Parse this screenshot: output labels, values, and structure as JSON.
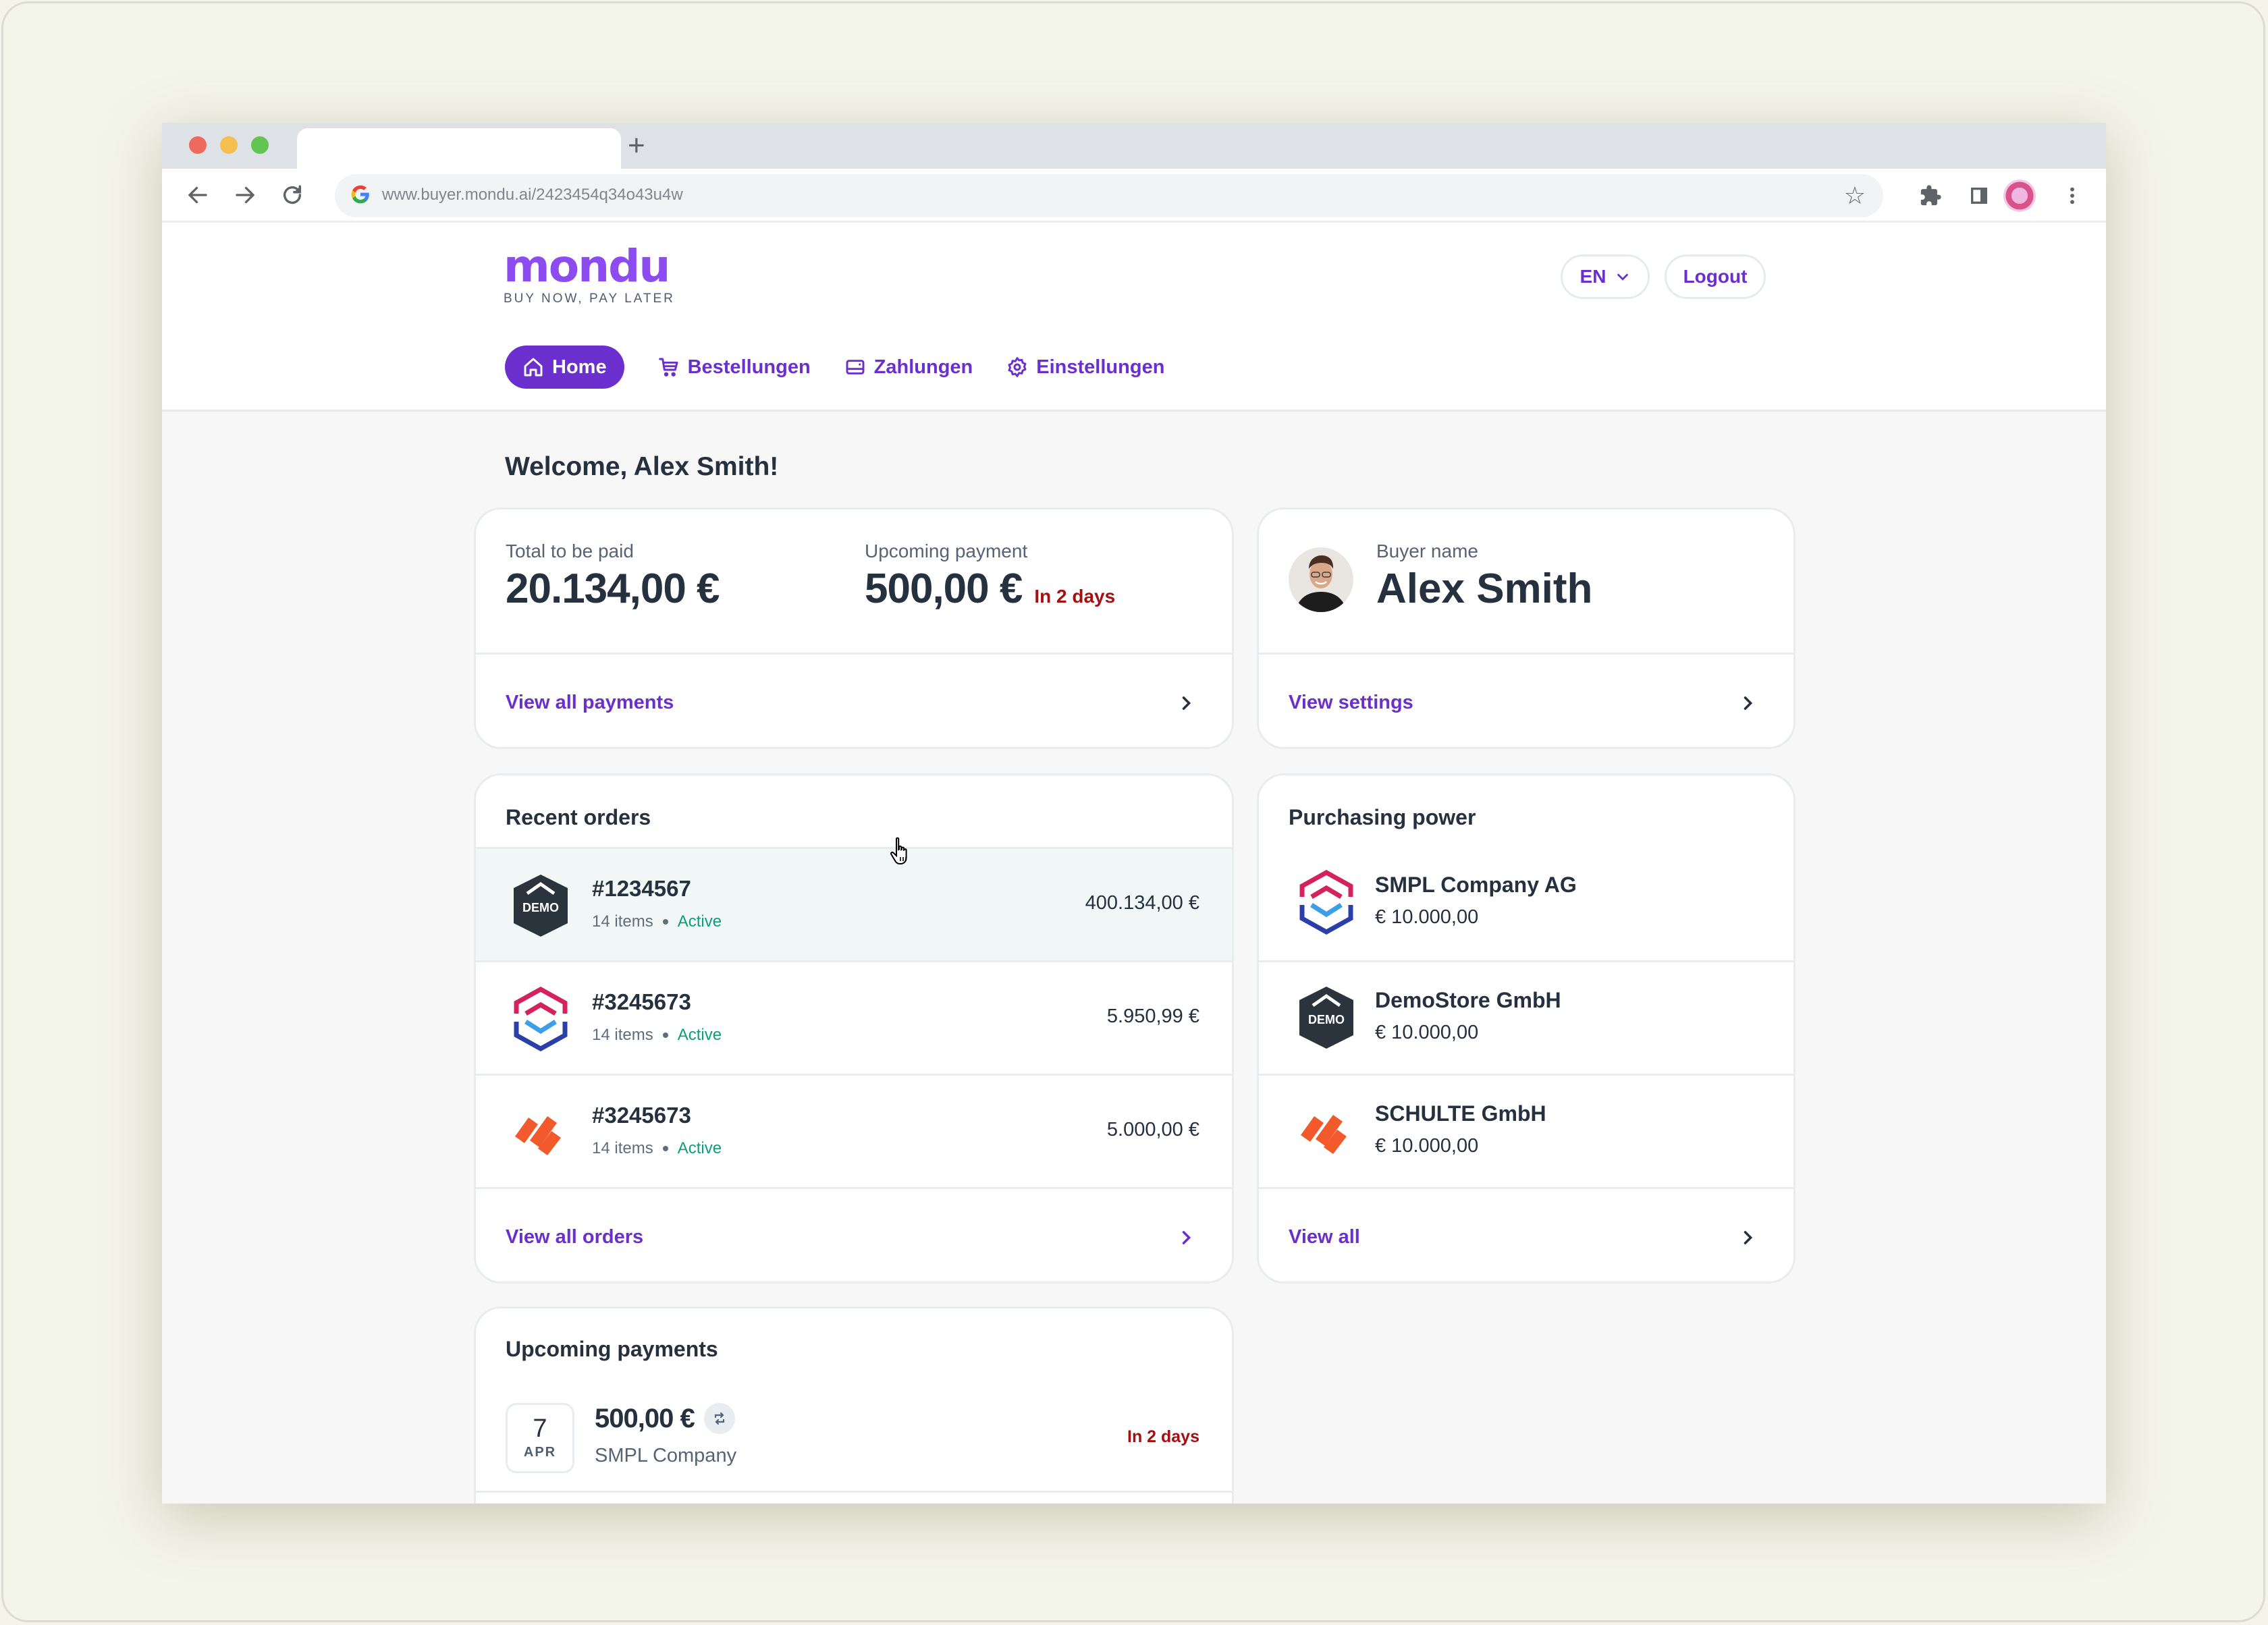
{
  "browser": {
    "url": "www.buyer.mondu.ai/2423454q34o43u4w",
    "new_tab_label": "+",
    "traffic_lights": [
      "#ed6a5e",
      "#f5bf4f",
      "#61c554"
    ],
    "icons": [
      "back-icon",
      "forward-icon",
      "reload-icon",
      "google-icon",
      "bookmark-star-icon",
      "extensions-icon",
      "side-panel-icon",
      "profile-avatar",
      "more-menu-icon"
    ]
  },
  "header": {
    "logo": "mondu",
    "tagline": "BUY NOW, PAY LATER",
    "language": "EN",
    "logout_label": "Logout",
    "nav": [
      {
        "label": "Home",
        "icon": "home-icon",
        "active": true
      },
      {
        "label": "Bestellungen",
        "icon": "cart-icon",
        "active": false
      },
      {
        "label": "Zahlungen",
        "icon": "wallet-icon",
        "active": false
      },
      {
        "label": "Einstellungen",
        "icon": "gear-icon",
        "active": false
      }
    ]
  },
  "colors": {
    "brand": "#6a2fcc",
    "logo": "#8c4cf0",
    "text": "#263140",
    "due": "#a3100f",
    "active": "#0f9d7a"
  },
  "welcome": "Welcome, Alex Smith!",
  "summary": {
    "total_label": "Total to be paid",
    "total_value": "20.134,00 €",
    "upcoming_label": "Upcoming payment",
    "upcoming_value": "500,00 €",
    "upcoming_due": "In 2 days",
    "link": "View all payments"
  },
  "buyer": {
    "label": "Buyer name",
    "name": "Alex Smith",
    "link": "View settings"
  },
  "recent_orders": {
    "title": "Recent orders",
    "orders": [
      {
        "id": "#1234567",
        "items": "14 items",
        "status": "Active",
        "amount": "400.134,00 €",
        "logo": "demo-store-logo"
      },
      {
        "id": "#3245673",
        "items": "14 items",
        "status": "Active",
        "amount": "5.950,99 €",
        "logo": "smpl-company-logo"
      },
      {
        "id": "#3245673",
        "items": "14 items",
        "status": "Active",
        "amount": "5.000,00 €",
        "logo": "schulte-logo"
      }
    ],
    "link": "View all orders"
  },
  "purchasing_power": {
    "title": "Purchasing power",
    "merchants": [
      {
        "name": "SMPL Company AG",
        "amount": "€ 10.000,00",
        "logo": "smpl-company-logo"
      },
      {
        "name": "DemoStore GmbH",
        "amount": "€ 10.000,00",
        "logo": "demo-store-logo"
      },
      {
        "name": "SCHULTE GmbH",
        "amount": "€ 10.000,00",
        "logo": "schulte-logo"
      }
    ],
    "link": "View all"
  },
  "upcoming_payments": {
    "title": "Upcoming payments",
    "payments": [
      {
        "day": "7",
        "month": "APR",
        "amount": "500,00 €",
        "merchant": "SMPL Company",
        "due": "In 2 days",
        "recurring": true
      }
    ]
  },
  "logo_texts": {
    "demo": "DEMO"
  }
}
